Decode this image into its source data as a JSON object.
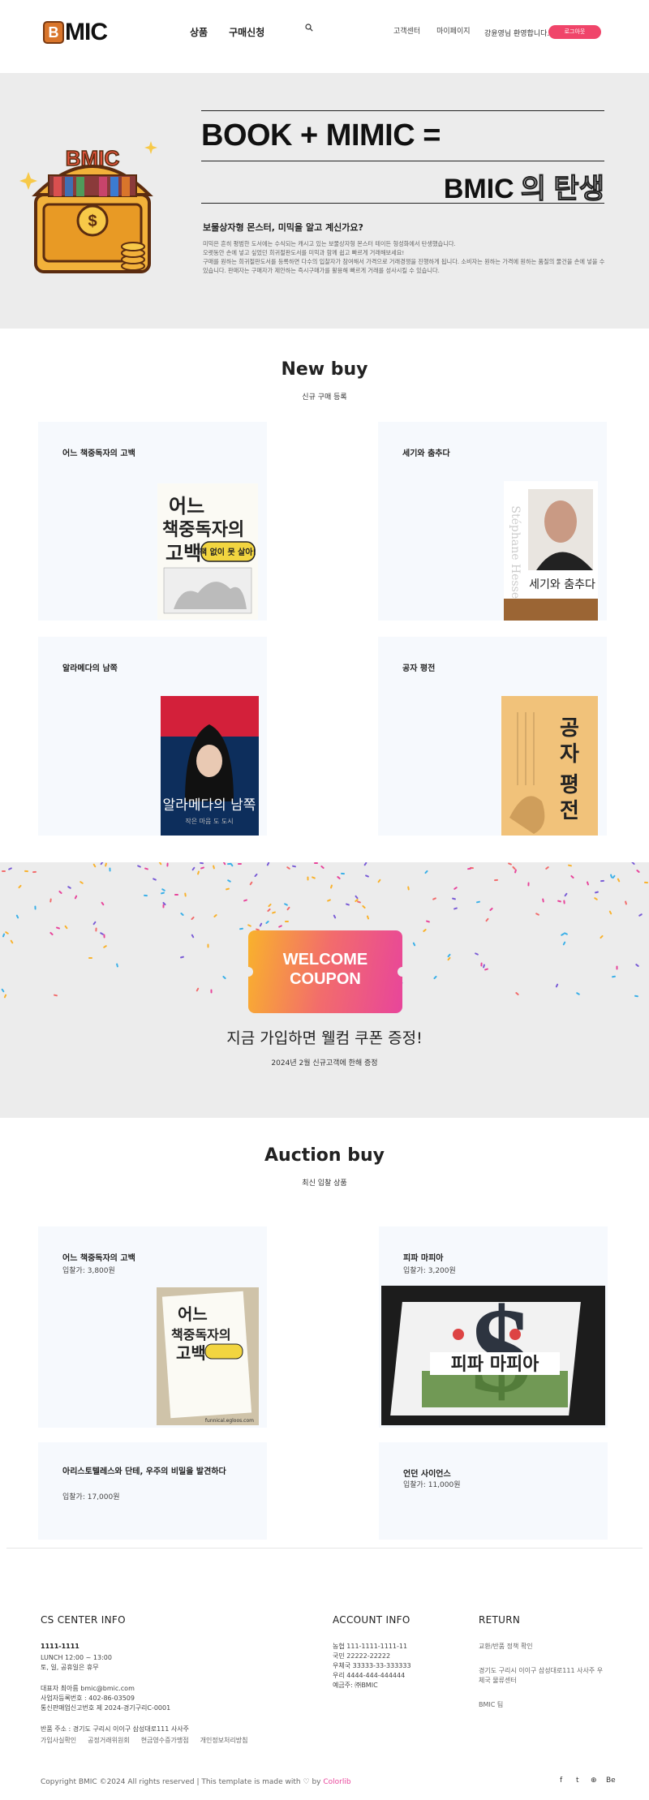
{
  "header": {
    "logo_text": "MIC",
    "logo_badge": "B",
    "nav": [
      "상품",
      "구매신청"
    ],
    "util": [
      "고객센터",
      "마이페이지"
    ],
    "welcome": "강윤영님 환영합니다.",
    "logout": "로그아웃"
  },
  "hero": {
    "headline": "BOOK + MIMIC =",
    "sub_head_solid": "BMIC",
    "sub_head_outline": "의 탄생",
    "chest_letters": "BMIC",
    "title": "보물상자형 몬스터, 미믹을 알고 계신가요?",
    "desc": [
      "미믹은 흔히 평범한 도서에는 수식되는 캐시고 있는 보물상자형 몬스터 테이든 형성화에서 탄생했습니다.",
      "오랫동안 손에 넣고 싶었던 희귀절판도서를 미믹과 함께 쉽고 빠르게 거래해보세요!",
      "구매를 원하는 희귀절판도서를 등록하면 다수의 입찰자가 참여해서 가격으로 거래경쟁을 진행하게 됩니다. 소비자는 원하는 가격에 원하는 품질의 물건을 손에 넣을 수 있습니다. 판매자는 구매자가 제안하는 즉시구매가를 활용해 빠르게 거래를 성사시킬 수 있습니다."
    ]
  },
  "new_buy": {
    "title": "New buy",
    "subtitle": "신규 구매 등록",
    "items": [
      {
        "title": "어느 책중독자의 고백"
      },
      {
        "title": "세기와 춤추다"
      },
      {
        "title": "알라메다의 남쪽"
      },
      {
        "title": "공자 평전"
      }
    ],
    "covers": {
      "c1_lines": [
        "어느",
        "책중독자의",
        "고백"
      ],
      "c1_badge": "책 없이 못 살아!",
      "c2_title": "세기와 춤추다",
      "c2_author": "Stéphane Hessel",
      "c3_title": "알라메다의 남쪽",
      "c3_sub": "작은 마음 도 도시",
      "c4_title": [
        "공",
        "자",
        "평",
        "전"
      ]
    }
  },
  "coupon": {
    "ticket_line1": "WELCOME",
    "ticket_line2": "COUPON",
    "title": "지금 가입하면 웰컴 쿠폰 증정!",
    "subtitle": "2024년 2월 신규고객에 한해 증정"
  },
  "auction": {
    "title": "Auction buy",
    "subtitle": "최신 입찰 상품",
    "items": [
      {
        "title": "어느 책중독자의 고백",
        "price": "입찰가: 3,800원"
      },
      {
        "title": "피파 마피아",
        "price": "입찰가: 3,200원"
      },
      {
        "title": "아리스토텔레스와 단테, 우주의 비밀을 발견하다",
        "price": "입찰가: 17,000원"
      },
      {
        "title": "언던 사이언스",
        "price": "입찰가: 11,000원"
      }
    ],
    "covers": {
      "a1_lines": [
        "어느",
        "책중독자의",
        "고백"
      ],
      "a1_caption": "funnical.egloos.com",
      "a2_title": "피파 마피아"
    }
  },
  "footer": {
    "cs_head": "CS CENTER INFO",
    "cs_phone": "1111-1111",
    "cs_hours": [
      "LUNCH 12:00 ~ 13:00",
      "토, 일, 공휴일은 휴무"
    ],
    "cs_company": [
      "대표자 최아름 bmic@bmic.com",
      "사업자등록번호 : 402-86-03509",
      "통신판매업신고번호 제 2024-경기구리C-0001"
    ],
    "cs_address": "반품 주소 : 경기도 구리시 이이구 삼성대로111 사사주",
    "cs_links": [
      "가입사실확인",
      "공정거래위원회",
      "현금영수증가맹점",
      "개인정보처리방침"
    ],
    "account_head": "ACCOUNT INFO",
    "accounts": [
      "농협 111-1111-1111-11",
      "국민 22222-22222",
      "우체국 33333-33-333333",
      "우리 4444-444-444444",
      "예금주: ㈜BMIC"
    ],
    "return_head": "RETURN",
    "return_items": [
      "교환/반품 정책 확인",
      "경기도 구리시 이이구 삼성대로111 사사주 우체국 물류센터",
      "BMIC 팀"
    ],
    "copyright_prefix": "Copyright BMIC ©2024 All rights reserved | This template is made with",
    "copyright_by": " by ",
    "copyright_brand": "Colorlib",
    "social": [
      "f",
      "t",
      "⊕",
      "Be"
    ]
  },
  "colors": {
    "accent": "#f0456a",
    "hero_bg": "#ececec",
    "card_bg": "#f6f9fd",
    "coupon_gradient": [
      "#f9b22c",
      "#f26c6c",
      "#e8459b"
    ]
  }
}
